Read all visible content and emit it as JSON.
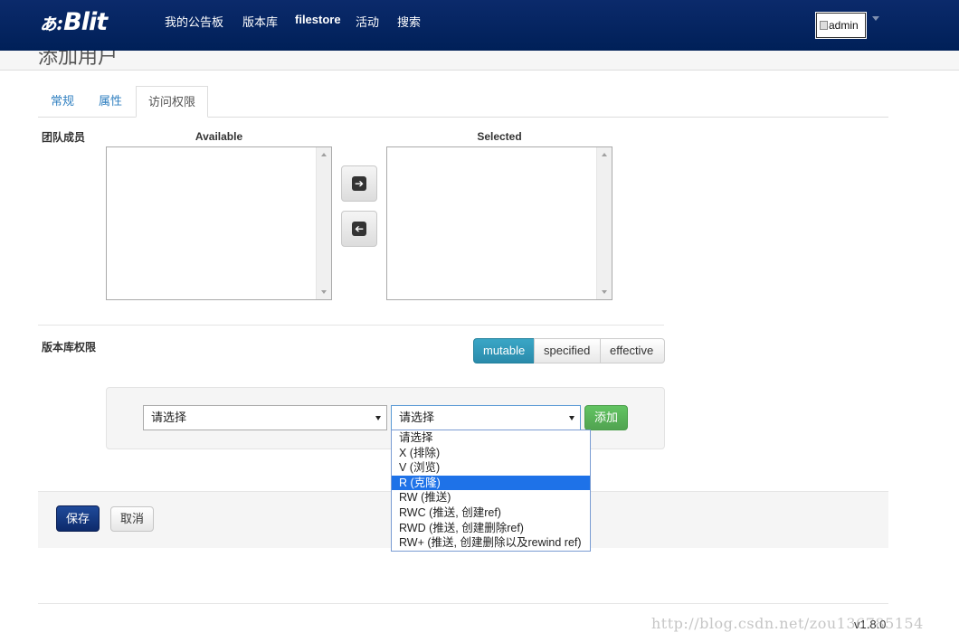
{
  "navbar": {
    "brand_mark": "ぁ:",
    "brand_text": "Blit",
    "items": [
      "我的公告板",
      "版本库",
      "filestore",
      "活动",
      "搜索"
    ],
    "user_alt": "admin"
  },
  "page": {
    "title": "添加用户"
  },
  "tabs": [
    "常规",
    "属性",
    "访问权限"
  ],
  "team": {
    "label": "团队成员",
    "available_header": "Available",
    "selected_header": "Selected",
    "move_right_icon": "arrow-right-icon",
    "move_left_icon": "arrow-left-icon"
  },
  "repo_permissions": {
    "label": "版本库权限",
    "modes": [
      "mutable",
      "specified",
      "effective"
    ],
    "active_mode": "mutable",
    "repo_select_value": "请选择",
    "perm_select_value": "请选择",
    "add_button": "添加",
    "perm_options": [
      "请选择",
      "X (排除)",
      "V (浏览)",
      "R (克隆)",
      "RW (推送)",
      "RWC (推送, 创建ref)",
      "RWD (推送, 创建删除ref)",
      "RW+ (推送, 创建删除以及rewind ref)"
    ],
    "highlighted_option": "R (克隆)"
  },
  "actions": {
    "save": "保存",
    "cancel": "取消"
  },
  "footer": {
    "version": "v1.8.0",
    "watermark": "http://blog.csdn.net/zou136785154"
  },
  "colors": {
    "navbar": "#002058",
    "active_mode": "#2f96b4",
    "add_button": "#51a351",
    "primary": "#0d2a6b",
    "highlight": "#1e72e8"
  }
}
